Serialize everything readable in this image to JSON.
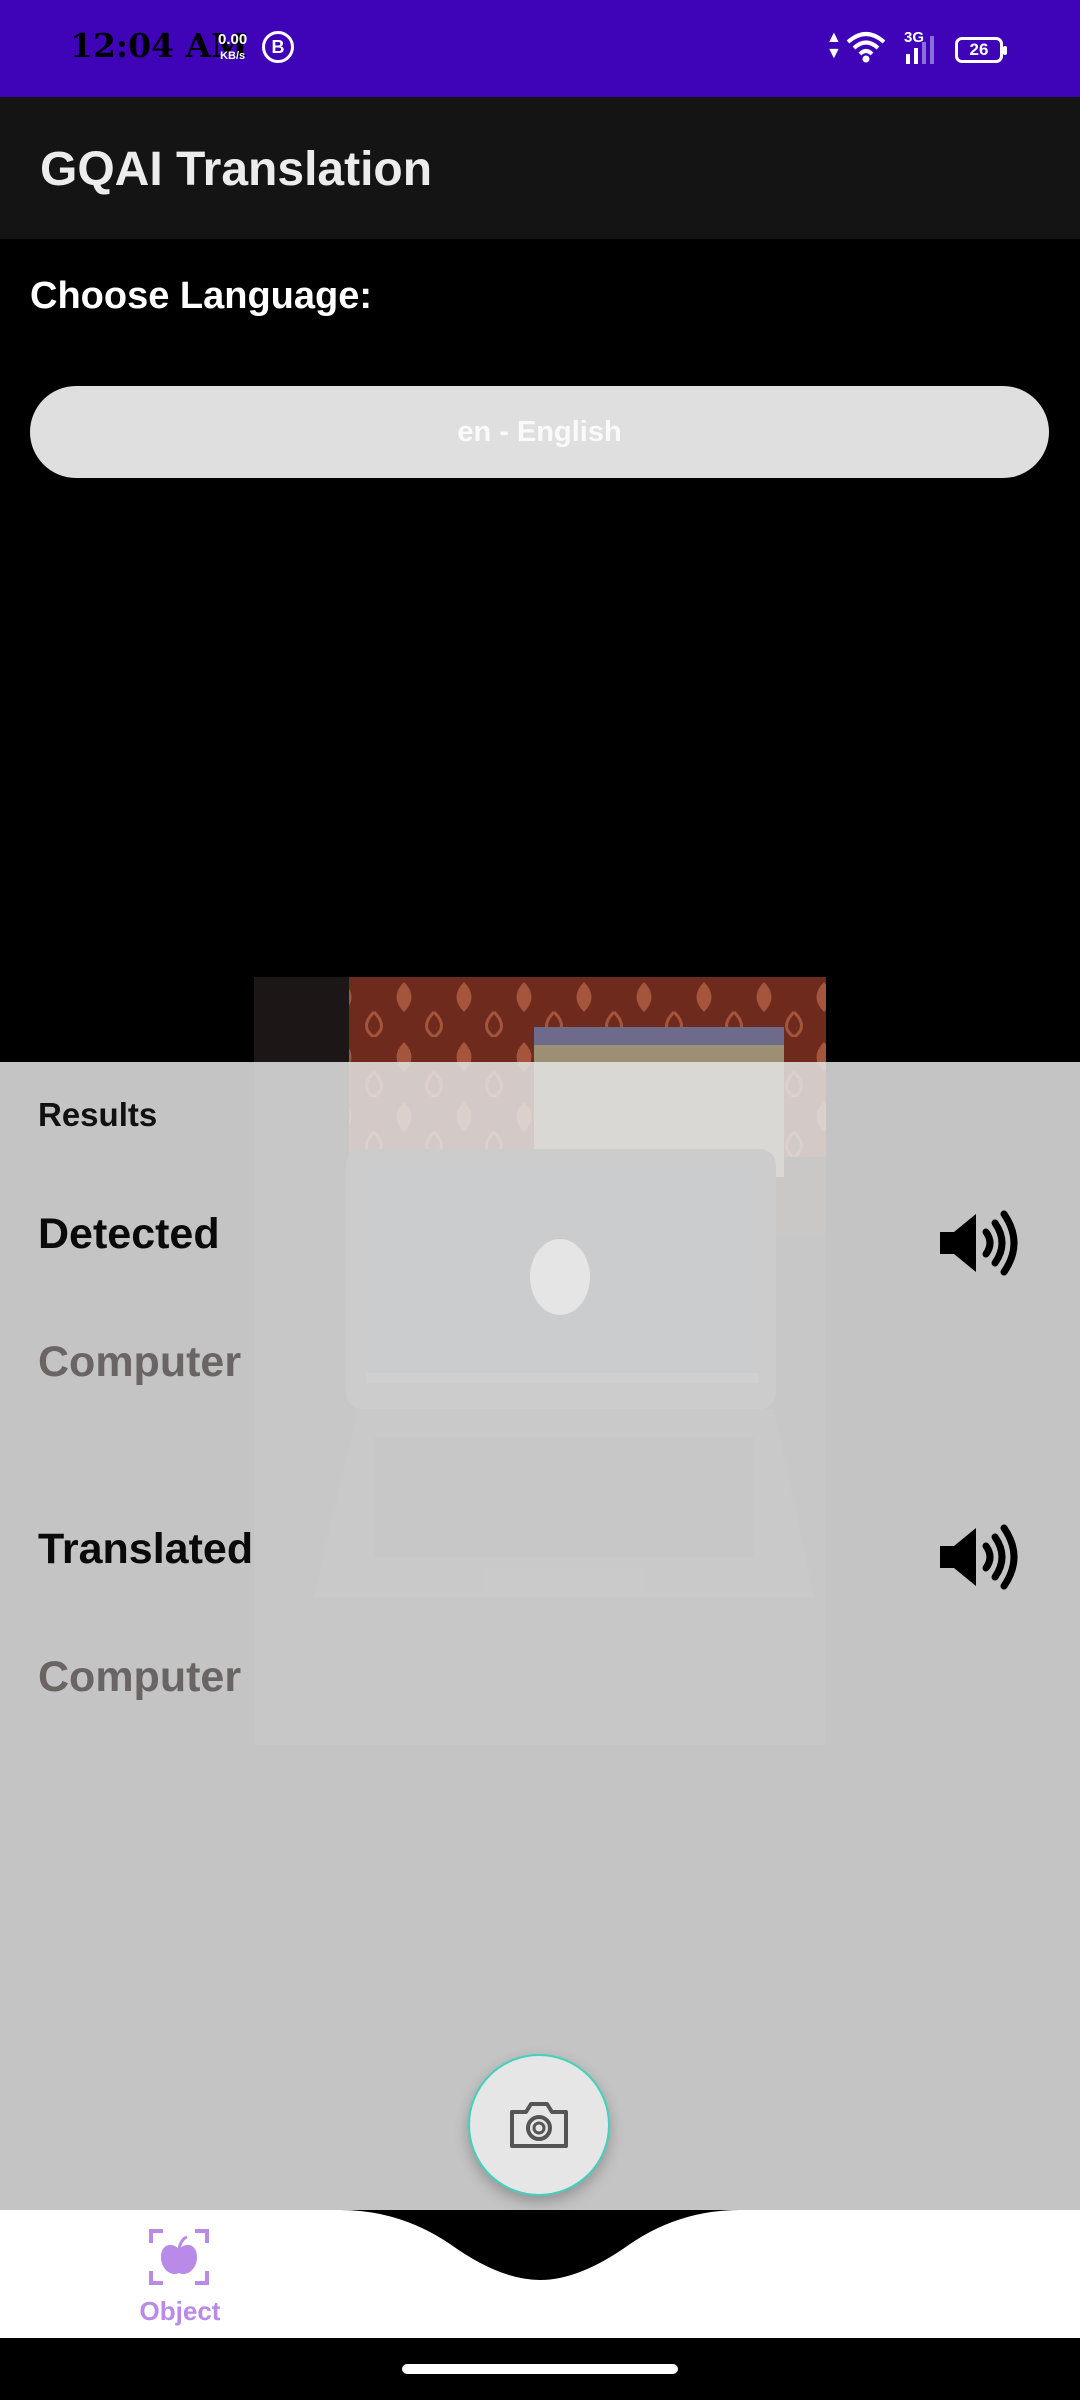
{
  "status_bar": {
    "time": "12:04 AM",
    "net_speed": "0.00",
    "net_speed_unit": "KB/s",
    "b_badge": "B",
    "network_type": "3G",
    "battery": "26",
    "icons": [
      "b-circle-icon",
      "data-arrows-icon",
      "wifi-icon",
      "signal-icon",
      "battery-icon"
    ]
  },
  "app_bar": {
    "title": "GQAI Translation"
  },
  "language": {
    "label": "Choose Language:",
    "selected": "en - English"
  },
  "results": {
    "title": "Results",
    "detected_label": "Detected",
    "detected_value": "Computer",
    "translated_label": "Translated",
    "translated_value": "Computer"
  },
  "camera_button": {
    "icon": "camera-icon"
  },
  "bottom_nav": {
    "items": [
      {
        "label": "Object",
        "icon": "apple-scan-icon",
        "active": true
      }
    ]
  },
  "colors": {
    "status_bar": "#3f04b8",
    "app_bar": "#141414",
    "accent": "#b98ae8",
    "fab_border": "#42d1bd"
  }
}
